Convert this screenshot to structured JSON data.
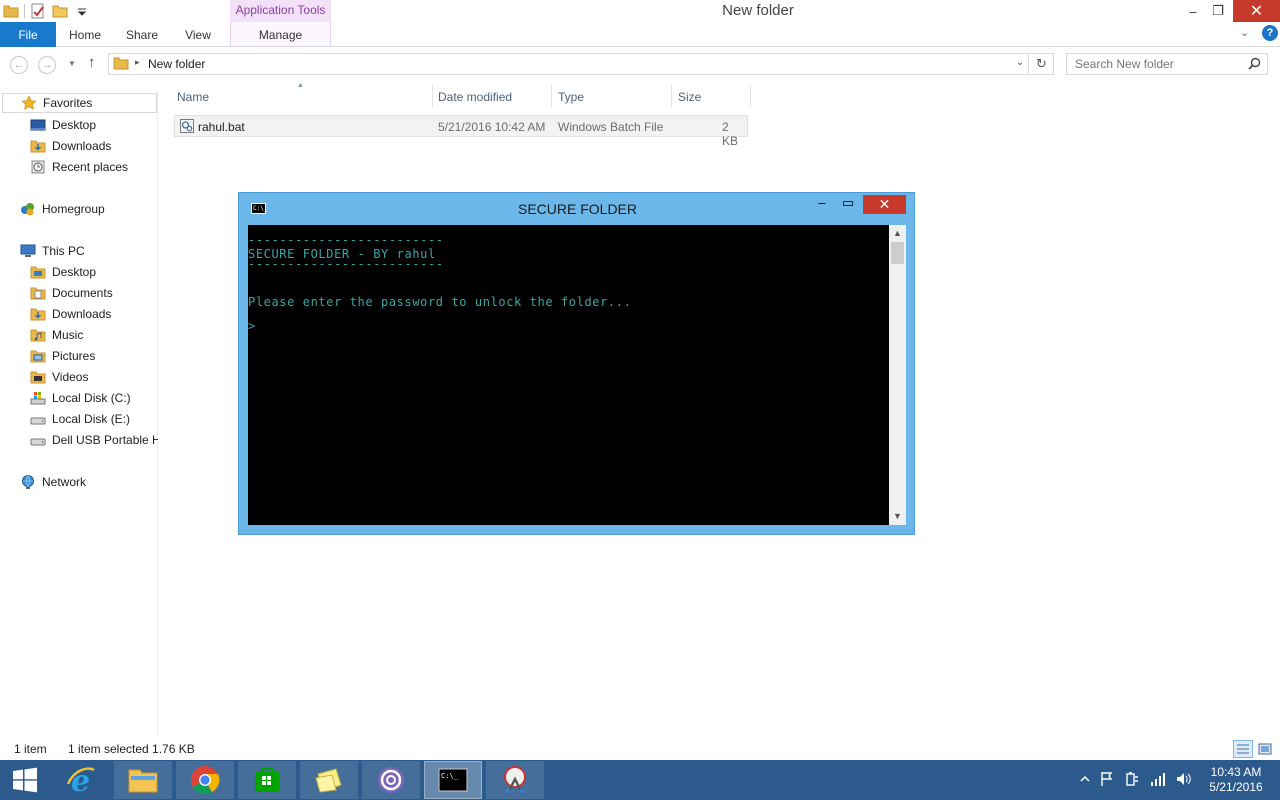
{
  "window": {
    "title": "New folder",
    "context_tab_header": "Application Tools",
    "controls": {
      "minimize": "–",
      "maximize": "❐",
      "close": "✕"
    }
  },
  "ribbon": {
    "tabs": [
      "File",
      "Home",
      "Share",
      "View",
      "Manage"
    ],
    "expand_glyph": "⌄",
    "help_glyph": "?"
  },
  "navbar": {
    "back_glyph": "←",
    "forward_glyph": "→",
    "recent_glyph": "▼",
    "up_glyph": "↑",
    "breadcrumb_separator": "▸",
    "path": "New folder",
    "dropdown_glyph": "⌄",
    "refresh_glyph": "↻",
    "search_placeholder": "Search New folder"
  },
  "navpane": {
    "favorites": {
      "label": "Favorites",
      "items": [
        "Desktop",
        "Downloads",
        "Recent places"
      ]
    },
    "homegroup": {
      "label": "Homegroup"
    },
    "this_pc": {
      "label": "This PC",
      "items": [
        "Desktop",
        "Documents",
        "Downloads",
        "Music",
        "Pictures",
        "Videos",
        "Local Disk (C:)",
        "Local Disk (E:)",
        "Dell USB Portable HDD"
      ]
    },
    "network": {
      "label": "Network"
    }
  },
  "filelist": {
    "columns": [
      "Name",
      "Date modified",
      "Type",
      "Size"
    ],
    "rows": [
      {
        "name": "rahul.bat",
        "date": "5/21/2016 10:42 AM",
        "type": "Windows Batch File",
        "size": "2 KB"
      }
    ]
  },
  "statusbar": {
    "count": "1 item",
    "selection": "1 item selected  1.76 KB"
  },
  "console": {
    "title": "SECURE FOLDER",
    "icon_text": "C:\\_",
    "lines": [
      "-------------------------",
      "SECURE FOLDER - BY rahul",
      "-------------------------",
      "",
      "Please enter the password to unlock the folder...",
      "",
      ">"
    ],
    "controls": {
      "minimize": "–",
      "maximize": "▭",
      "close": "✕"
    },
    "scroll_up": "▲",
    "scroll_down": "▼"
  },
  "taskbar": {
    "apps": [
      "start",
      "internet-explorer",
      "file-explorer",
      "chrome",
      "store",
      "sticky-notes",
      "bittorrent",
      "command-prompt",
      "snipping-tool"
    ],
    "clock_time": "10:43 AM",
    "clock_date": "5/21/2016"
  },
  "colors": {
    "file_tab": "#1979ca",
    "context_tab_text": "#8b3ea2",
    "console_frame": "#6cb7e9",
    "console_text": "#3aa7a5",
    "taskbar": "#2c5a8c",
    "close_button": "#c7392b"
  }
}
